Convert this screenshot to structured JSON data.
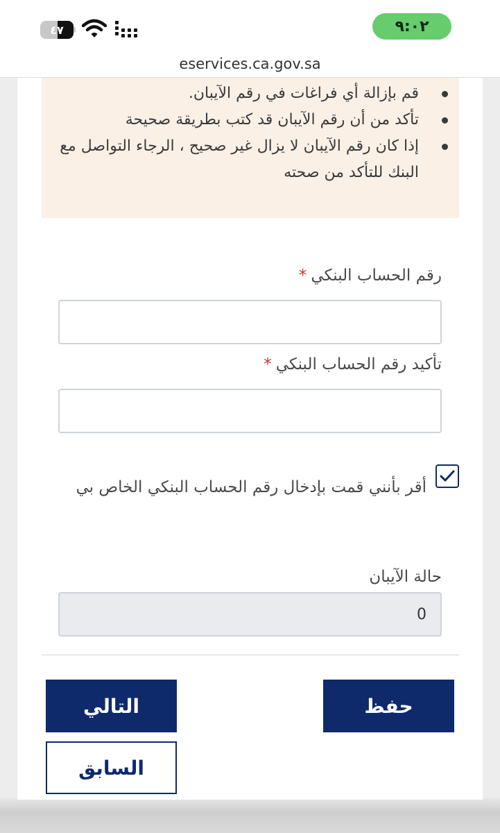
{
  "status_bar": {
    "time": "٩:٠٢",
    "battery_level": "٤٧",
    "battery_fraction": 0.47
  },
  "browser": {
    "url": "eservices.ca.gov.sa"
  },
  "notice": {
    "items": [
      "قم بإزالة أي فراغات في رقم الآيبان.",
      "تأكد من أن رقم الآيبان قد كتب بطريقة صحيحة",
      "إذا كان رقم الآيبان لا يزال غير صحيح ، الرجاء التواصل مع البنك للتأكد من صحته"
    ]
  },
  "form": {
    "required_mark": "*",
    "account_number": {
      "label": "رقم الحساب البنكي",
      "value": ""
    },
    "confirm_account_number": {
      "label": "تأكيد رقم الحساب البنكي",
      "value": ""
    },
    "consent": {
      "checked": true,
      "text": "أقر بأنني قمت بإدخال رقم الحساب البنكي الخاص بي"
    },
    "iban_status": {
      "label": "حالة الآيبان",
      "value": "0"
    }
  },
  "buttons": {
    "save": "حفظ",
    "next": "التالي",
    "previous": "السابق"
  },
  "colors": {
    "primary": "#0f2a6b",
    "notice_bg": "#faf0e6",
    "time_pill": "#66cc6e",
    "required": "#c0392b"
  },
  "icons": {
    "signal": "cellular-signal-icon",
    "wifi": "wifi-icon",
    "battery": "battery-icon",
    "checkbox": "checkmark-icon"
  }
}
